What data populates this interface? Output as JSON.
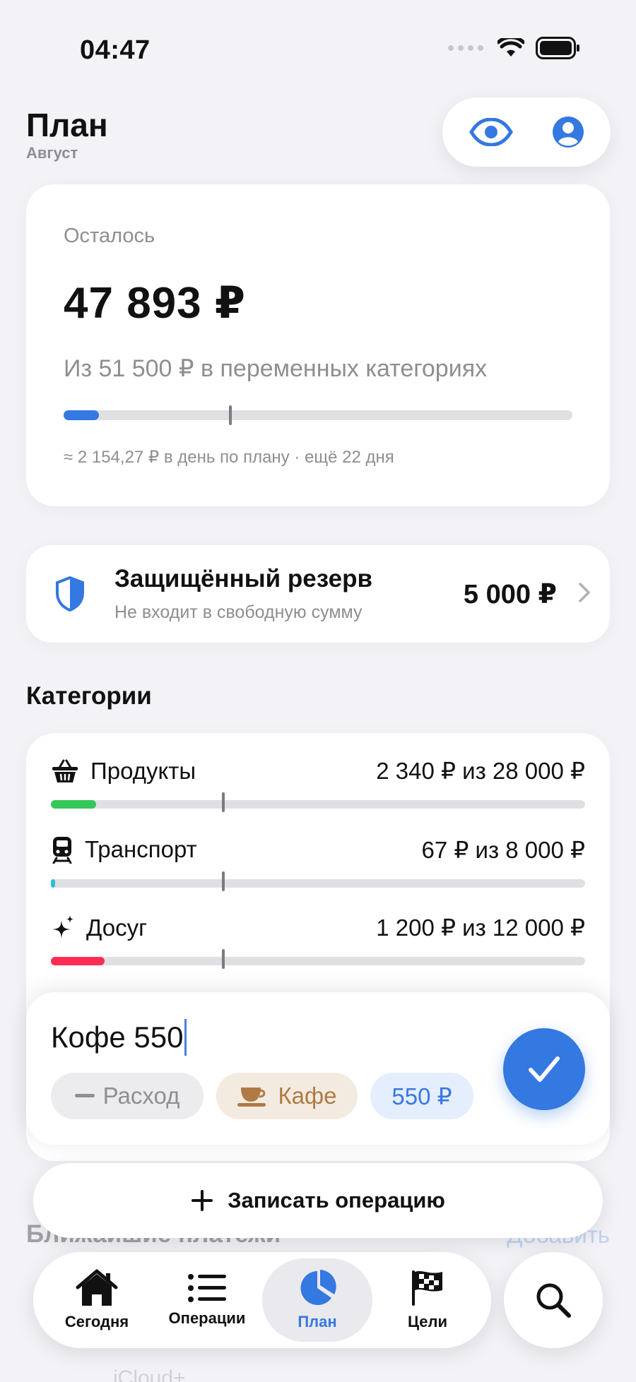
{
  "status_bar": {
    "time": "04:47"
  },
  "header": {
    "title": "План",
    "subtitle": "Август"
  },
  "summary": {
    "remaining_label": "Осталось",
    "remaining_amount": "47 893 ₽",
    "plan_note": "Из 51 500 ₽ в переменных категориях",
    "progress_fraction": 0.07,
    "expected_fraction": 0.325,
    "daily_note": "≈ 2 154,27 ₽ в день по плану · ещё 22 дня"
  },
  "reserve": {
    "title": "Защищённый резерв",
    "subtitle": "Не входит в свободную сумму",
    "amount": "5 000 ₽"
  },
  "categories": {
    "title": "Категории",
    "items": [
      {
        "name": "Продукты",
        "amount": "2 340 ₽ из 28 000 ₽",
        "icon": "basket-icon",
        "color": "#34c759",
        "fraction": 0.084,
        "expected_fraction": 0.32
      },
      {
        "name": "Транспорт",
        "amount": "67 ₽ из 8 000 ₽",
        "icon": "train-icon",
        "color": "#30c0d0",
        "fraction": 0.008,
        "expected_fraction": 0.32
      },
      {
        "name": "Досуг",
        "amount": "1 200 ₽ из 12 000 ₽",
        "icon": "sparkles-icon",
        "color": "#ff2d55",
        "fraction": 0.1,
        "expected_fraction": 0.32
      }
    ]
  },
  "entry": {
    "text": "Кофе 550",
    "chips": {
      "type": "Расход",
      "category": "Кафе",
      "amount": "550 ₽"
    }
  },
  "record_button": {
    "label": "Записать операцию"
  },
  "upcoming": {
    "title": "Ближайшие платежи",
    "add": "Добавить",
    "first_item": "iCloud+"
  },
  "tabs": [
    {
      "label": "Сегодня",
      "icon": "house-icon"
    },
    {
      "label": "Операции",
      "icon": "list-icon"
    },
    {
      "label": "План",
      "icon": "pie-chart-icon",
      "active": true
    },
    {
      "label": "Цели",
      "icon": "flag-icon"
    }
  ],
  "colors": {
    "accent": "#3478e2",
    "background": "#f2f2f7"
  }
}
